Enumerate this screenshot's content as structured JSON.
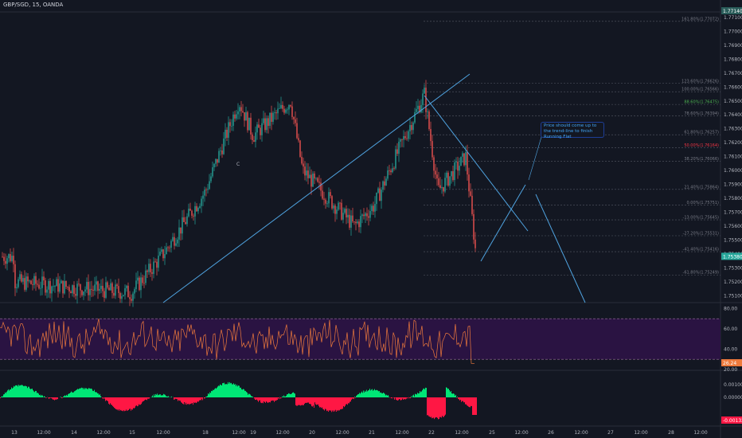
{
  "title": "GBP/SGD, 15, OANDA",
  "note": "Price should come up to the trend-line to finish Running Flat",
  "wave_label": "C",
  "colors": {
    "background": "#131722",
    "bull": "#26a69a",
    "bear": "#ef5350",
    "trendline": "#4fa3e0",
    "rsi_line": "#ef7a3c",
    "rsi_band": "#2a1342",
    "osc_up": "#00e676",
    "osc_down": "#ff1744",
    "fib_text": "#787b86"
  },
  "price_axis": {
    "ticks": [
      "1.77100",
      "1.77000",
      "1.76900",
      "1.76800",
      "1.76700",
      "1.76600",
      "1.76500",
      "1.76400",
      "1.76300",
      "1.76200",
      "1.76100",
      "1.76000",
      "1.75900",
      "1.75800",
      "1.75700",
      "1.75600",
      "1.75500",
      "1.75400",
      "1.75300",
      "1.75200",
      "1.75100"
    ],
    "current_top": "1.77140",
    "current_price": "1.75380"
  },
  "fib_levels": [
    {
      "label": "161.80%(1.77072)",
      "value": 1.77072,
      "color": "#787b86"
    },
    {
      "label": "123.60%(1.76626)",
      "value": 1.76626,
      "color": "#787b86"
    },
    {
      "label": "100.00%(1.76566)",
      "value": 1.76566,
      "color": "#787b86"
    },
    {
      "label": "88.60%(1.76475)",
      "value": 1.76475,
      "color": "#4caf50"
    },
    {
      "label": "78.60%(1.76394)",
      "value": 1.76394,
      "color": "#787b86"
    },
    {
      "label": "61.80%(1.76257)",
      "value": 1.76257,
      "color": "#787b86"
    },
    {
      "label": "50.00%(1.76164)",
      "value": 1.76164,
      "color": "#f23645"
    },
    {
      "label": "38.20%(1.76066)",
      "value": 1.76066,
      "color": "#787b86"
    },
    {
      "label": "21.40%(1.75864)",
      "value": 1.75864,
      "color": "#787b86"
    },
    {
      "label": "0.00%(1.75751)",
      "value": 1.75751,
      "color": "#787b86"
    },
    {
      "label": "-13.00%(1.75645)",
      "value": 1.75645,
      "color": "#787b86"
    },
    {
      "label": "-27.20%(1.75531)",
      "value": 1.75531,
      "color": "#787b86"
    },
    {
      "label": "-41.40%(1.75416)",
      "value": 1.75416,
      "color": "#787b86"
    },
    {
      "label": "-61.80%(1.75249)",
      "value": 1.75249,
      "color": "#787b86"
    }
  ],
  "rsi_axis": {
    "ticks": [
      "80.00",
      "60.00",
      "40.00",
      "20.00"
    ],
    "current": "26.24"
  },
  "osc_axis": {
    "ticks": [
      "0.00100",
      "0.00000"
    ],
    "current": "-0.00132"
  },
  "time_axis": [
    "13",
    "12:00",
    "14",
    "12:00",
    "15",
    "12:00",
    "18",
    "12:00",
    "19",
    "12:00",
    "20",
    "12:00",
    "21",
    "12:00",
    "22",
    "12:00",
    "25",
    "12:00",
    "26",
    "12:00",
    "27",
    "12:00",
    "28",
    "12:00"
  ],
  "chart_data": {
    "type": "candlestick",
    "title": "GBP/SGD, 15, OANDA",
    "ylim": [
      1.7505,
      1.7718
    ],
    "description_points": [
      {
        "x": "13",
        "y": 1.752
      },
      {
        "x": "15",
        "y": 1.7512
      },
      {
        "x": "15 12:00",
        "y": 1.754
      },
      {
        "x": "18",
        "y": 1.7585
      },
      {
        "x": "18 12:00",
        "y": 1.765
      },
      {
        "x": "19",
        "y": 1.7625
      },
      {
        "x": "19 12:00",
        "y": 1.765
      },
      {
        "x": "20",
        "y": 1.76
      },
      {
        "x": "20 12:00",
        "y": 1.756
      },
      {
        "x": "21",
        "y": 1.7575
      },
      {
        "x": "21 12:00",
        "y": 1.762
      },
      {
        "x": "22",
        "y": 1.7655
      },
      {
        "x": "22 06:00",
        "y": 1.7585
      },
      {
        "x": "22 12:00",
        "y": 1.761
      },
      {
        "x": "22 18:00",
        "y": 1.7538
      }
    ]
  }
}
